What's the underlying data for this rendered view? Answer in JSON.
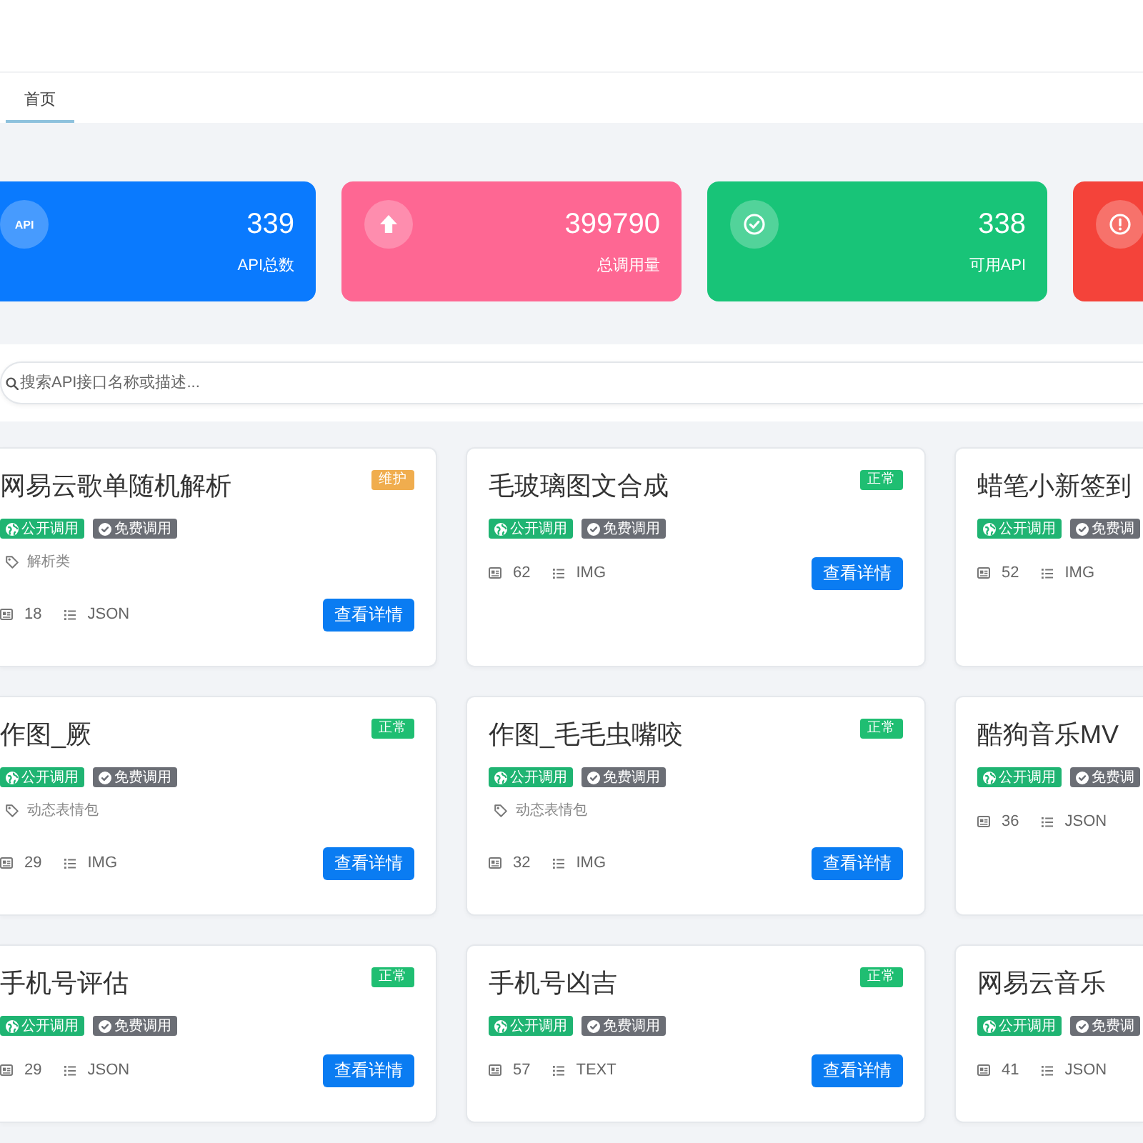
{
  "tabs": [
    {
      "label": "首页",
      "selected": true
    }
  ],
  "stats": [
    {
      "kind": "api",
      "icon_text": "API",
      "value": "339",
      "label": "API总数"
    },
    {
      "kind": "calls",
      "value": "399790",
      "label": "总调用量"
    },
    {
      "kind": "available",
      "value": "338",
      "label": "可用API"
    },
    {
      "kind": "error"
    }
  ],
  "search": {
    "placeholder": "搜索API接口名称或描述..."
  },
  "apis": [
    {
      "title": "网易云歌单随机解析",
      "status": {
        "label": "维护",
        "kind": "maintenance"
      },
      "tags": [
        {
          "label": "公开调用",
          "kind": "public"
        },
        {
          "label": "免费调用",
          "kind": "free"
        }
      ],
      "category": "解析类",
      "count": "18",
      "format": "JSON",
      "button": "查看详情"
    },
    {
      "title": "毛玻璃图文合成",
      "status": {
        "label": "正常",
        "kind": "normal"
      },
      "tags": [
        {
          "label": "公开调用",
          "kind": "public"
        },
        {
          "label": "免费调用",
          "kind": "free"
        }
      ],
      "count": "62",
      "format": "IMG",
      "button": "查看详情"
    },
    {
      "title": "蜡笔小新签到",
      "tags": [
        {
          "label": "公开调用",
          "kind": "public"
        },
        {
          "label": "免费调",
          "kind": "free"
        }
      ],
      "count": "52",
      "format": "IMG"
    },
    {
      "title": "作图_厥",
      "status": {
        "label": "正常",
        "kind": "normal"
      },
      "tags": [
        {
          "label": "公开调用",
          "kind": "public"
        },
        {
          "label": "免费调用",
          "kind": "free"
        }
      ],
      "category": "动态表情包",
      "count": "29",
      "format": "IMG",
      "button": "查看详情"
    },
    {
      "title": "作图_毛毛虫嘴咬",
      "status": {
        "label": "正常",
        "kind": "normal"
      },
      "tags": [
        {
          "label": "公开调用",
          "kind": "public"
        },
        {
          "label": "免费调用",
          "kind": "free"
        }
      ],
      "category": "动态表情包",
      "count": "32",
      "format": "IMG",
      "button": "查看详情"
    },
    {
      "title": "酷狗音乐MV",
      "tags": [
        {
          "label": "公开调用",
          "kind": "public"
        },
        {
          "label": "免费调",
          "kind": "free"
        }
      ],
      "count": "36",
      "format": "JSON"
    },
    {
      "title": "手机号评估",
      "status": {
        "label": "正常",
        "kind": "normal"
      },
      "tags": [
        {
          "label": "公开调用",
          "kind": "public"
        },
        {
          "label": "免费调用",
          "kind": "free"
        }
      ],
      "count": "29",
      "format": "JSON",
      "button": "查看详情"
    },
    {
      "title": "手机号凶吉",
      "status": {
        "label": "正常",
        "kind": "normal"
      },
      "tags": [
        {
          "label": "公开调用",
          "kind": "public"
        },
        {
          "label": "免费调用",
          "kind": "free"
        }
      ],
      "count": "57",
      "format": "TEXT",
      "button": "查看详情"
    },
    {
      "title": "网易云音乐",
      "tags": [
        {
          "label": "公开调用",
          "kind": "public"
        },
        {
          "label": "免费调",
          "kind": "free"
        }
      ],
      "count": "41",
      "format": "JSON"
    }
  ]
}
